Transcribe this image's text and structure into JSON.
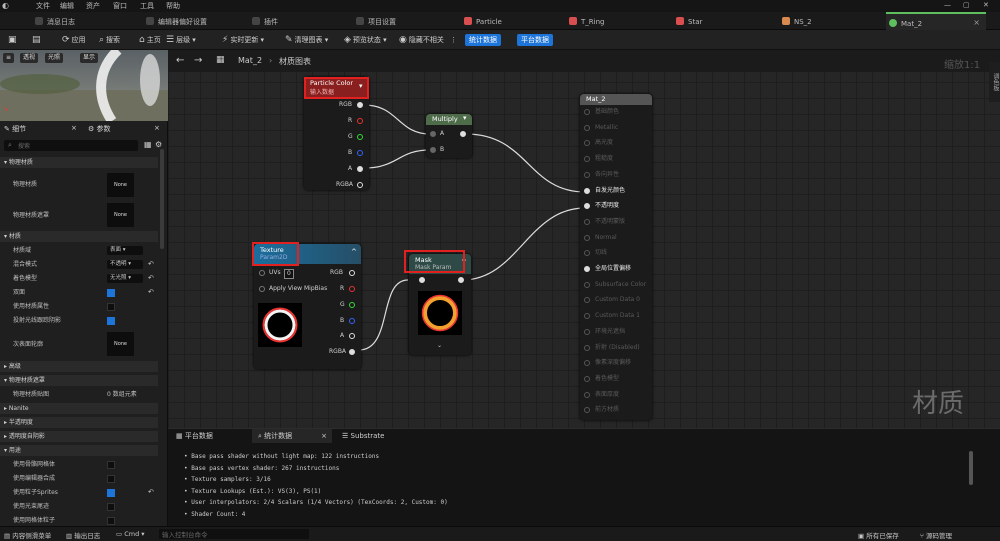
{
  "menubar": {
    "items": [
      "文件",
      "编辑",
      "资产",
      "窗口",
      "工具",
      "帮助"
    ]
  },
  "tabs": [
    {
      "label": "消息日志",
      "color": "#888888"
    },
    {
      "label": "编辑器偏好设置",
      "color": "#888888"
    },
    {
      "label": "插件",
      "color": "#888888"
    },
    {
      "label": "项目设置",
      "color": "#888888"
    },
    {
      "label": "Particle",
      "color": "#d94f4f"
    },
    {
      "label": "T_Ring",
      "color": "#d94f4f"
    },
    {
      "label": "Star",
      "color": "#d94f4f"
    },
    {
      "label": "NS_2",
      "color": "#d98a4f"
    },
    {
      "label": "Mat_2",
      "color": "#5fbf5f"
    }
  ],
  "toolbar": {
    "apply": "应用",
    "search": "搜索",
    "home": "主页",
    "hierarchy": "层级",
    "live_update": "实时更新",
    "clean_graph": "清理图表",
    "preview_state": "预览状态",
    "hide_unrelated": "隐藏不相关",
    "stats": "统计数据",
    "platform": "平台数据"
  },
  "preview": {
    "btn_persp": "透视",
    "btn_lit": "光照",
    "btn_show": "显示"
  },
  "details": {
    "tab_details": "细节",
    "tab_params": "参数",
    "search_placeholder": "搜索",
    "sections": {
      "physmat": "物理材质",
      "material": "材质",
      "advanced": "高级",
      "physmask": "物理材质遮罩",
      "nanite": "Nanite",
      "translucency": "半透明度",
      "translucent_shadow": "透明度自阴影",
      "usage": "用途"
    },
    "rows": {
      "phys": "物理材质",
      "physmask": "物理材质遮罩",
      "domain": "材质域",
      "blend": "混合模式",
      "shading": "着色模型",
      "twosided": "双面",
      "use_mat_attr": "使用材质属性",
      "cast_shadow": "投射光线跟踪阴影",
      "subsurface": "次表面轮廓",
      "phys_map": "物理材质贴图",
      "skel": "使用骨骼网格体",
      "editor_comp": "使用编辑器合成",
      "sprites": "使用粒子Sprites",
      "beam": "使用光束尾迹",
      "mesh_part": "使用网格体粒子"
    },
    "values": {
      "domain": "表面",
      "blend": "不透明",
      "shading": "无光照",
      "none": "None",
      "elements": "0 数组元素"
    }
  },
  "graph": {
    "back": "Mat_2",
    "crumb": "材质图表",
    "zoom": "缩放1:1",
    "watermark": "材质"
  },
  "nodes": {
    "particle": {
      "title": "Particle Color",
      "sub": "输入数据",
      "pins": [
        "RGB",
        "R",
        "G",
        "B",
        "A",
        "RGBA"
      ]
    },
    "multiply": {
      "title": "Multiply",
      "pins": [
        "A",
        "B"
      ]
    },
    "texture": {
      "title": "Texture",
      "sub": "Param2D",
      "uvs": "UVs",
      "uvs_val": "0",
      "mip": "Apply View MipBias",
      "pins": [
        "RGB",
        "R",
        "G",
        "B",
        "A",
        "RGBA"
      ]
    },
    "mask": {
      "title": "Mask",
      "sub": "Mask Param"
    },
    "result": {
      "title": "Mat_2",
      "pins": [
        "基础颜色",
        "Metallic",
        "高光度",
        "粗糙度",
        "各向异性",
        "自发光颜色",
        "不透明度",
        "不透明蒙版",
        "Normal",
        "切线",
        "全局位置偏移",
        "Subsurface Color",
        "Custom Data 0",
        "Custom Data 1",
        "环境光遮挡",
        "折射 (Disabled)",
        "像素深度偏移",
        "着色模型",
        "表面厚度",
        "前方材质"
      ]
    }
  },
  "bottom": {
    "tab_platform": "平台数据",
    "tab_stats": "统计数据",
    "tab_substrate": "Substrate",
    "stats": [
      "Base pass shader without light map: 122 instructions",
      "Base pass vertex shader: 267 instructions",
      "Texture samplers: 3/16",
      "Texture Lookups (Est.): VS(3), PS(1)",
      "User interpolators: 2/4 Scalars (1/4 Vectors) (TexCoords: 2, Custom: 0)",
      "Shader Count: 4"
    ]
  },
  "status": {
    "drawer": "内容侧滑菜单",
    "output": "输出日志",
    "cmd": "Cmd",
    "cmd_placeholder": "输入控制台命令",
    "saved": "所有已保存",
    "source": "源码管理"
  },
  "sidestrip": "调色板"
}
